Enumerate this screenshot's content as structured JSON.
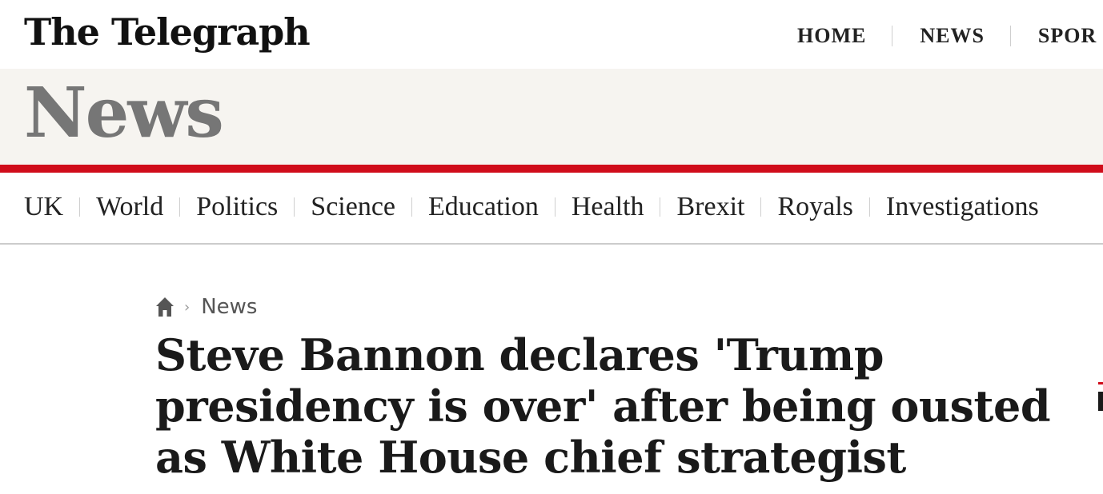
{
  "brand": {
    "logo_text": "The Telegraph"
  },
  "top_nav": {
    "items": [
      {
        "label": "HOME"
      },
      {
        "label": "NEWS"
      },
      {
        "label": "SPOR"
      }
    ]
  },
  "section": {
    "title": "News"
  },
  "sub_nav": {
    "items": [
      {
        "label": "UK"
      },
      {
        "label": "World"
      },
      {
        "label": "Politics"
      },
      {
        "label": "Science"
      },
      {
        "label": "Education"
      },
      {
        "label": "Health"
      },
      {
        "label": "Brexit"
      },
      {
        "label": "Royals"
      },
      {
        "label": "Investigations"
      }
    ]
  },
  "breadcrumb": {
    "home_icon": "home-icon",
    "separator": "›",
    "current": "News"
  },
  "article": {
    "headline": "Steve Bannon declares 'Trump presidency is over' after being ousted as White House chief strategist"
  },
  "colors": {
    "accent_red": "#d00c1a",
    "banner_bg": "#f6f4f0",
    "section_title": "#767676"
  }
}
